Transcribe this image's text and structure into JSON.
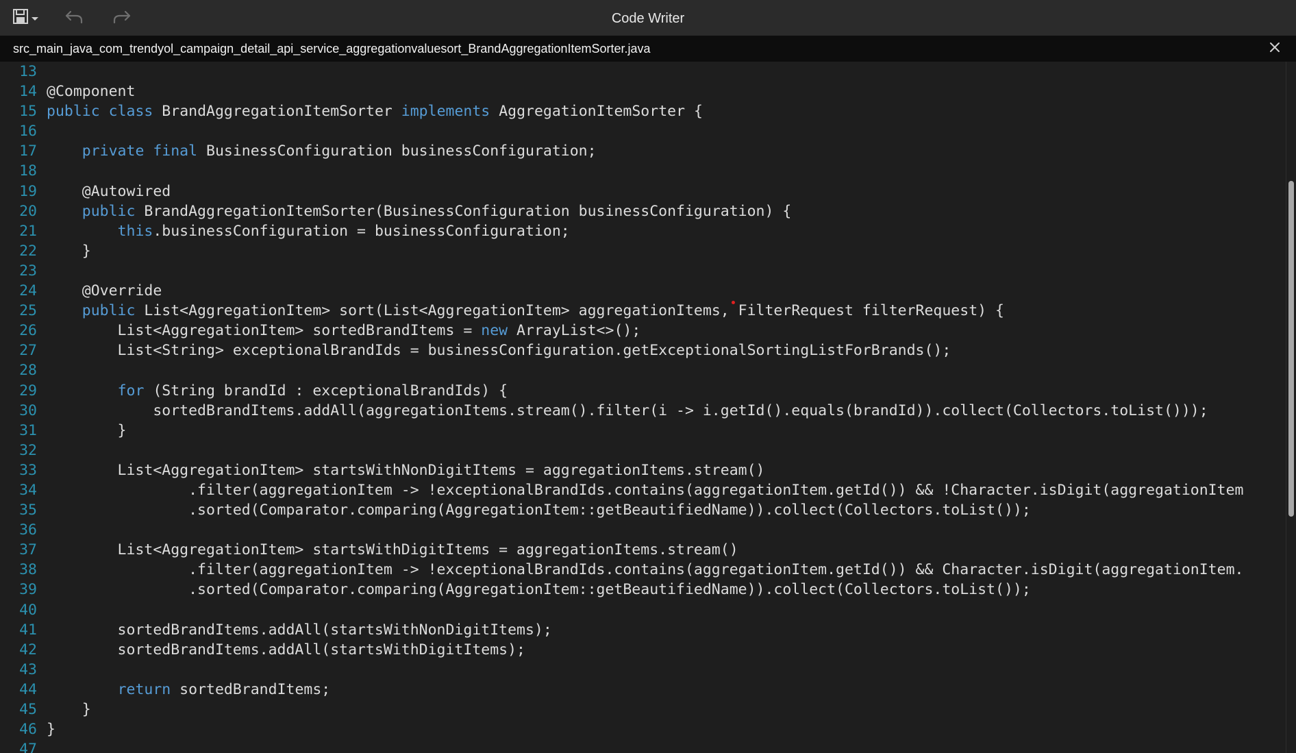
{
  "app": {
    "title": "Code Writer"
  },
  "toolbar": {
    "save_icon": "save-icon",
    "dropdown_icon": "chevron-down-icon",
    "undo_icon": "undo-icon",
    "redo_icon": "redo-icon"
  },
  "tab": {
    "filename": "src_main_java_com_trendyol_campaign_detail_api_service_aggregationvaluesort_BrandAggregationItemSorter.java",
    "close_icon": "close-icon"
  },
  "colors": {
    "background": "#1e1e1e",
    "line_number": "#2b91af",
    "keyword": "#569cd6",
    "text": "#dcdcdc"
  },
  "code": {
    "lines": [
      {
        "number": "13",
        "segments": [
          {
            "t": ""
          }
        ]
      },
      {
        "number": "14",
        "segments": [
          {
            "t": "@Component"
          }
        ]
      },
      {
        "number": "15",
        "segments": [
          {
            "t": "public",
            "k": true
          },
          {
            "t": " "
          },
          {
            "t": "class",
            "k": true
          },
          {
            "t": " BrandAggregationItemSorter "
          },
          {
            "t": "implements",
            "k": true
          },
          {
            "t": " AggregationItemSorter {"
          }
        ]
      },
      {
        "number": "16",
        "segments": [
          {
            "t": ""
          }
        ]
      },
      {
        "number": "17",
        "segments": [
          {
            "t": "    "
          },
          {
            "t": "private",
            "k": true
          },
          {
            "t": " "
          },
          {
            "t": "final",
            "k": true
          },
          {
            "t": " BusinessConfiguration businessConfiguration;"
          }
        ]
      },
      {
        "number": "18",
        "segments": [
          {
            "t": ""
          }
        ]
      },
      {
        "number": "19",
        "segments": [
          {
            "t": "    @Autowired"
          }
        ]
      },
      {
        "number": "20",
        "segments": [
          {
            "t": "    "
          },
          {
            "t": "public",
            "k": true
          },
          {
            "t": " BrandAggregationItemSorter(BusinessConfiguration businessConfiguration) {"
          }
        ]
      },
      {
        "number": "21",
        "segments": [
          {
            "t": "        "
          },
          {
            "t": "this",
            "k": true
          },
          {
            "t": ".businessConfiguration = businessConfiguration;"
          }
        ]
      },
      {
        "number": "22",
        "segments": [
          {
            "t": "    }"
          }
        ]
      },
      {
        "number": "23",
        "segments": [
          {
            "t": ""
          }
        ]
      },
      {
        "number": "24",
        "segments": [
          {
            "t": "    @Override"
          }
        ]
      },
      {
        "number": "25",
        "segments": [
          {
            "t": "    "
          },
          {
            "t": "public",
            "k": true
          },
          {
            "t": " List<AggregationItem> sort(List<AggregationItem> aggregationItems, FilterRequest filterRequest) {"
          }
        ]
      },
      {
        "number": "26",
        "segments": [
          {
            "t": "        List<AggregationItem> sortedBrandItems = "
          },
          {
            "t": "new",
            "k": true
          },
          {
            "t": " ArrayList<>();"
          }
        ]
      },
      {
        "number": "27",
        "segments": [
          {
            "t": "        List<String> exceptionalBrandIds = businessConfiguration.getExceptionalSortingListForBrands();"
          }
        ]
      },
      {
        "number": "28",
        "segments": [
          {
            "t": ""
          }
        ]
      },
      {
        "number": "29",
        "segments": [
          {
            "t": "        "
          },
          {
            "t": "for",
            "k": true
          },
          {
            "t": " (String brandId : exceptionalBrandIds) {"
          }
        ]
      },
      {
        "number": "30",
        "segments": [
          {
            "t": "            sortedBrandItems.addAll(aggregationItems.stream().filter(i -> i.getId().equals(brandId)).collect(Collectors.toList()));"
          }
        ]
      },
      {
        "number": "31",
        "segments": [
          {
            "t": "        }"
          }
        ]
      },
      {
        "number": "32",
        "segments": [
          {
            "t": ""
          }
        ]
      },
      {
        "number": "33",
        "segments": [
          {
            "t": "        List<AggregationItem> startsWithNonDigitItems = aggregationItems.stream()"
          }
        ]
      },
      {
        "number": "34",
        "segments": [
          {
            "t": "                .filter(aggregationItem -> !exceptionalBrandIds.contains(aggregationItem.getId()) && !Character.isDigit(aggregationItem"
          }
        ]
      },
      {
        "number": "35",
        "segments": [
          {
            "t": "                .sorted(Comparator.comparing(AggregationItem::getBeautifiedName)).collect(Collectors.toList());"
          }
        ]
      },
      {
        "number": "36",
        "segments": [
          {
            "t": ""
          }
        ]
      },
      {
        "number": "37",
        "segments": [
          {
            "t": "        List<AggregationItem> startsWithDigitItems = aggregationItems.stream()"
          }
        ]
      },
      {
        "number": "38",
        "segments": [
          {
            "t": "                .filter(aggregationItem -> !exceptionalBrandIds.contains(aggregationItem.getId()) && Character.isDigit(aggregationItem."
          }
        ]
      },
      {
        "number": "39",
        "segments": [
          {
            "t": "                .sorted(Comparator.comparing(AggregationItem::getBeautifiedName)).collect(Collectors.toList());"
          }
        ]
      },
      {
        "number": "40",
        "segments": [
          {
            "t": ""
          }
        ]
      },
      {
        "number": "41",
        "segments": [
          {
            "t": "        sortedBrandItems.addAll(startsWithNonDigitItems);"
          }
        ]
      },
      {
        "number": "42",
        "segments": [
          {
            "t": "        sortedBrandItems.addAll(startsWithDigitItems);"
          }
        ]
      },
      {
        "number": "43",
        "segments": [
          {
            "t": ""
          }
        ]
      },
      {
        "number": "44",
        "segments": [
          {
            "t": "        "
          },
          {
            "t": "return",
            "k": true
          },
          {
            "t": " sortedBrandItems;"
          }
        ]
      },
      {
        "number": "45",
        "segments": [
          {
            "t": "    }"
          }
        ]
      },
      {
        "number": "46",
        "segments": [
          {
            "t": "}"
          }
        ]
      },
      {
        "number": "47",
        "segments": [
          {
            "t": ""
          }
        ]
      }
    ]
  }
}
